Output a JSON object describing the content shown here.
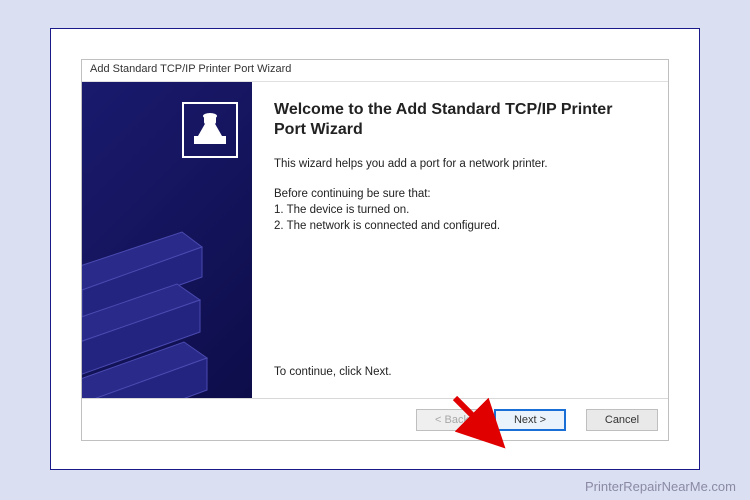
{
  "window": {
    "title": "Add Standard TCP/IP Printer Port Wizard"
  },
  "content": {
    "heading": "Welcome to the Add Standard TCP/IP Printer Port Wizard",
    "intro": "This wizard helps you add a port for a network printer.",
    "before_label": "Before continuing be sure that:",
    "checklist": {
      "item1": "1.  The device is turned on.",
      "item2": "2.  The network is connected and configured."
    },
    "continue_hint": "To continue, click Next."
  },
  "buttons": {
    "back": "< Back",
    "next": "Next >",
    "cancel": "Cancel"
  },
  "watermark": "PrinterRepairNearMe.com"
}
